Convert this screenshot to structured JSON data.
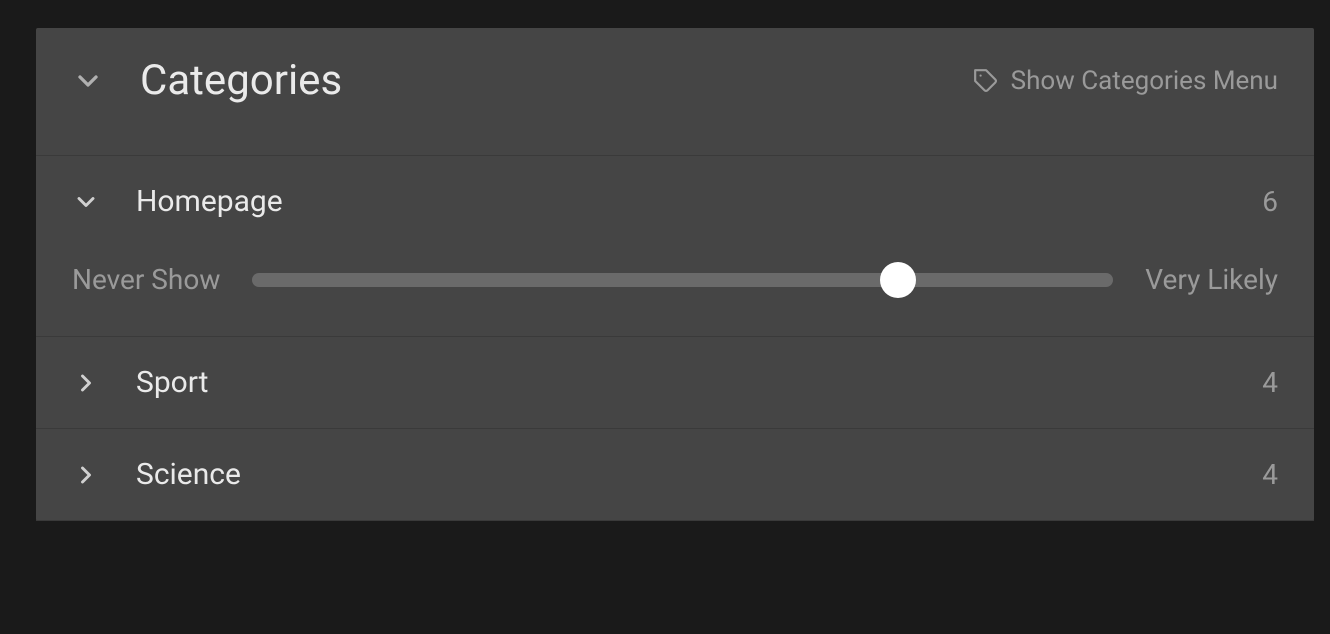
{
  "header": {
    "title": "Categories",
    "menu_label": "Show Categories Menu"
  },
  "slider": {
    "label_min": "Never Show",
    "label_max": "Very Likely",
    "max": 8
  },
  "categories": [
    {
      "name": "Homepage",
      "count": "6",
      "expanded": true,
      "value": 6
    },
    {
      "name": "Sport",
      "count": "4",
      "expanded": false,
      "value": 4
    },
    {
      "name": "Science",
      "count": "4",
      "expanded": false,
      "value": 4
    }
  ]
}
